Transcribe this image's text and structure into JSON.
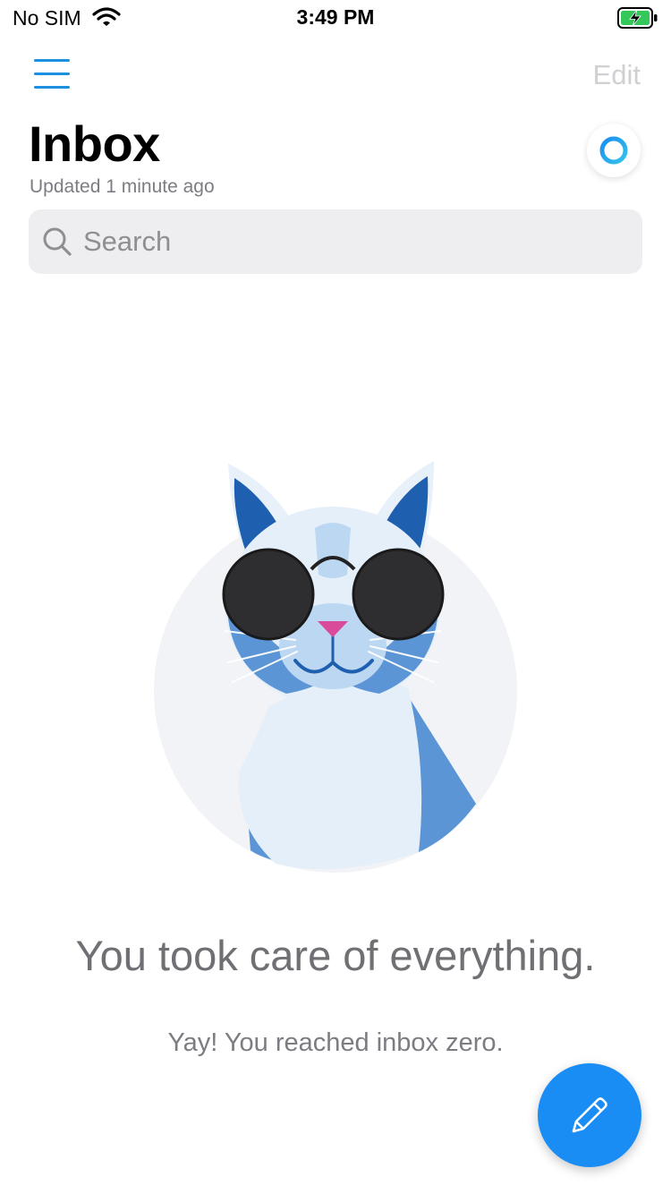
{
  "status_bar": {
    "carrier": "No SIM",
    "time": "3:49 PM",
    "wifi_icon": "wifi-icon",
    "battery_icon": "battery-charging-icon"
  },
  "header": {
    "menu_icon": "hamburger-menu-icon",
    "edit_label": "Edit",
    "title": "Inbox",
    "updated": "Updated 1 minute ago",
    "sync_icon": "sync-ring-icon"
  },
  "search": {
    "placeholder": "Search",
    "icon": "search-icon"
  },
  "empty_state": {
    "illustration": "cat-with-sunglasses",
    "title": "You took care of everything.",
    "subtitle": "Yay! You reached inbox zero."
  },
  "compose": {
    "icon": "pencil-icon"
  },
  "colors": {
    "accent": "#1a8df5",
    "menu_lines": "#1c8fe0",
    "edit_disabled": "#d0d0d4",
    "search_bg": "#eeeef0",
    "battery_green": "#34c759"
  }
}
